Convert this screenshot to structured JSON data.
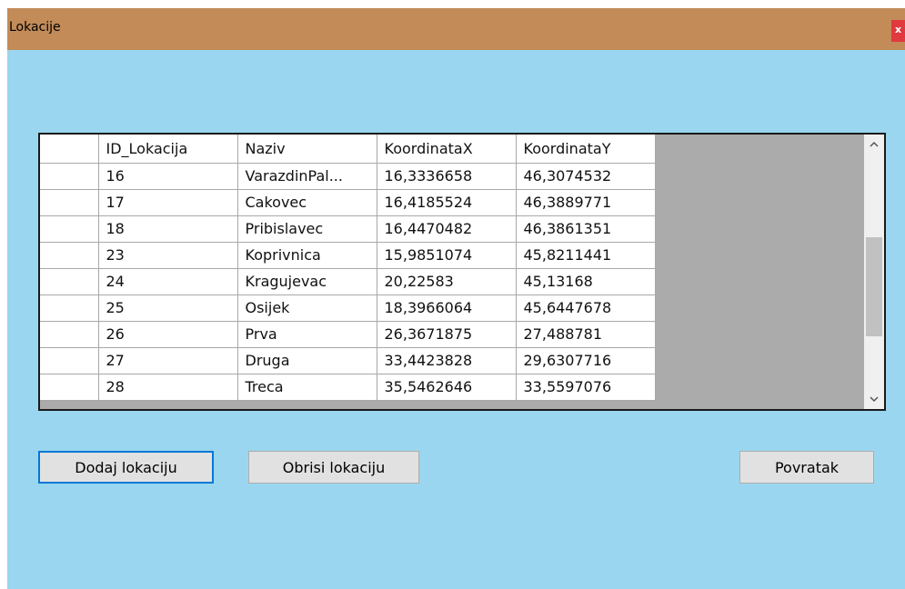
{
  "window": {
    "title": "Lokacije",
    "close_label": "x"
  },
  "grid": {
    "columns": [
      "ID_Lokacija",
      "Naziv",
      "KoordinataX",
      "KoordinataY"
    ],
    "rows": [
      [
        "16",
        "VarazdinPal...",
        "16,3336658",
        "46,3074532"
      ],
      [
        "17",
        "Cakovec",
        "16,4185524",
        "46,3889771"
      ],
      [
        "18",
        "Pribislavec",
        "16,4470482",
        "46,3861351"
      ],
      [
        "23",
        "Koprivnica",
        "15,9851074",
        "45,8211441"
      ],
      [
        "24",
        "Kragujevac",
        "20,22583",
        "45,13168"
      ],
      [
        "25",
        "Osijek",
        "18,3966064",
        "45,6447678"
      ],
      [
        "26",
        "Prva",
        "26,3671875",
        "27,488781"
      ],
      [
        "27",
        "Druga",
        "33,4423828",
        "29,6307716"
      ],
      [
        "28",
        "Treca",
        "35,5462646",
        "33,5597076"
      ]
    ],
    "scroll_up": "^",
    "scroll_down": "v"
  },
  "buttons": {
    "add": "Dodaj lokaciju",
    "delete": "Obrisi lokaciju",
    "back": "Povratak"
  },
  "colors": {
    "titlebar": "#c28b58",
    "background": "#9ad6ef",
    "close": "#e0393e",
    "focus": "#0078d7"
  }
}
